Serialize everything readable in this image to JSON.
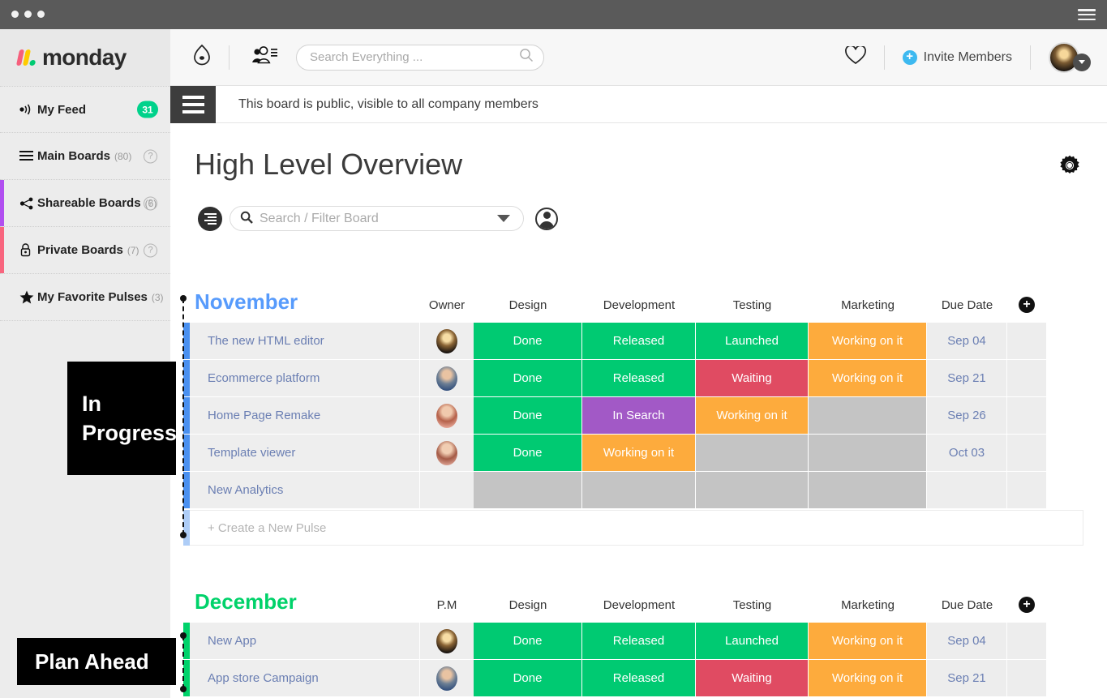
{
  "window": {
    "dots": 3,
    "menu_icon": "hamburger-icon"
  },
  "brand": {
    "name": "monday"
  },
  "sidebar": {
    "items": [
      {
        "label": "My Feed",
        "count": "",
        "icon": "feed-icon",
        "badge": "31",
        "accent": ""
      },
      {
        "label": "Main Boards",
        "count": "(80)",
        "icon": "list-icon",
        "help": "?",
        "accent": ""
      },
      {
        "label": "Shareable Boards",
        "count": "(6)",
        "icon": "share-icon",
        "help": "?",
        "accent": "#b14ff0"
      },
      {
        "label": "Private Boards",
        "count": "(7)",
        "icon": "lock-icon",
        "help": "?",
        "accent": "#f8657e"
      },
      {
        "label": "My Favorite Pulses",
        "count": "(3)",
        "icon": "star-icon",
        "accent": ""
      }
    ]
  },
  "topbar": {
    "bell_icon": "notification-bell-icon",
    "people_icon": "people-list-icon",
    "search": {
      "placeholder": "Search Everything ...",
      "value": "",
      "icon": "search-icon"
    },
    "heart_icon": "heart-icon",
    "invite_label": "Invite Members",
    "invite_icon": "plus-circle-icon",
    "avatar": "user-avatar",
    "avatar_caret": "chevron-down-icon"
  },
  "notice": {
    "menu_icon": "board-menu-icon",
    "text": "This board is public, visible to all company members"
  },
  "board": {
    "title": "High Level Overview",
    "settings_icon": "gear-icon",
    "filter": {
      "left_icon": "filter-icon",
      "search_icon": "search-icon",
      "placeholder": "Search / Filter Board",
      "value": "",
      "caret_icon": "chevron-down-icon",
      "person_icon": "person-filter-icon"
    },
    "add_column_icon": "plus-icon",
    "new_pulse_label": "+ Create a New Pulse",
    "groups": [
      {
        "name": "November",
        "color": "#579bfc",
        "row_accent": "#4a90f0",
        "columns": [
          "Owner",
          "Design",
          "Development",
          "Testing",
          "Marketing",
          "Due Date"
        ],
        "rows": [
          {
            "name": "The new HTML editor",
            "owner": "avatar-1",
            "design": "Done",
            "development": "Released",
            "testing": "Launched",
            "marketing": "Working on it",
            "due": "Sep 04"
          },
          {
            "name": "Ecommerce platform",
            "owner": "avatar-2",
            "design": "Done",
            "development": "Released",
            "testing": "Waiting",
            "marketing": "Working on it",
            "due": "Sep 21"
          },
          {
            "name": "Home Page Remake",
            "owner": "avatar-3",
            "design": "Done",
            "development": "In Search",
            "testing": "Working on it",
            "marketing": "",
            "due": "Sep 26"
          },
          {
            "name": "Template viewer",
            "owner": "avatar-4",
            "design": "Done",
            "development": "Working on it",
            "testing": "",
            "marketing": "",
            "due": "Oct 03"
          },
          {
            "name": "New Analytics",
            "owner": "",
            "design": "",
            "development": "",
            "testing": "",
            "marketing": "",
            "due": ""
          }
        ]
      },
      {
        "name": "December",
        "color": "#00d26a",
        "row_accent": "#00d26a",
        "columns": [
          "P.M",
          "Design",
          "Development",
          "Testing",
          "Marketing",
          "Due Date"
        ],
        "rows": [
          {
            "name": "New App",
            "owner": "avatar-1",
            "design": "Done",
            "development": "Released",
            "testing": "Launched",
            "marketing": "Working on it",
            "due": "Sep 04"
          },
          {
            "name": "App store Campaign",
            "owner": "avatar-2",
            "design": "Done",
            "development": "Released",
            "testing": "Waiting",
            "marketing": "Working on it",
            "due": "Sep 21"
          }
        ]
      }
    ]
  },
  "callouts": [
    {
      "id": "in-progress",
      "text": "In\nProgress"
    },
    {
      "id": "plan-ahead",
      "text": "Plan Ahead"
    }
  ],
  "status_colors": {
    "Done": "#00ca72",
    "Released": "#00ca72",
    "Launched": "#00ca72",
    "Working on it": "#fdab3d",
    "Waiting": "#e04b62",
    "In Search": "#a259c6",
    "empty": "#c4c4c4"
  },
  "accents": {
    "brand_green": "#00ca72",
    "brand_blue": "#579bfc",
    "badge_green": "#00d28b",
    "invite_blue": "#3db9f0"
  }
}
